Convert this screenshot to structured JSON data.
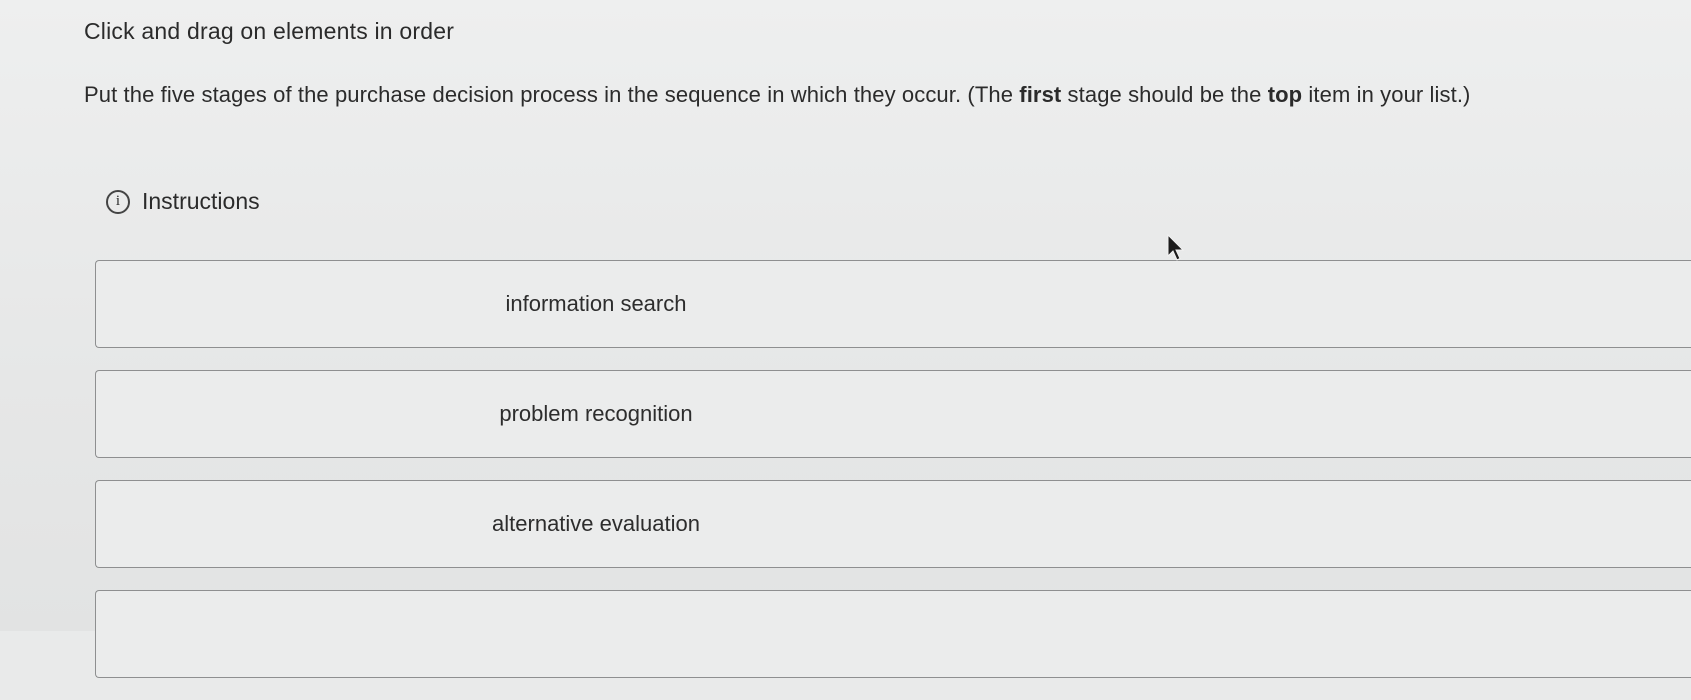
{
  "heading": "Click and drag on elements in order",
  "question": {
    "part1": "Put the five stages of the purchase decision process in the sequence in which they occur. (The ",
    "bold1": "first",
    "part2": " stage should be the ",
    "bold2": "top",
    "part3": " item in your list.)"
  },
  "instructions": {
    "icon": "info-icon",
    "label": "Instructions"
  },
  "items": [
    {
      "label": "information search"
    },
    {
      "label": "problem recognition"
    },
    {
      "label": "alternative evaluation"
    },
    {
      "label": ""
    }
  ]
}
